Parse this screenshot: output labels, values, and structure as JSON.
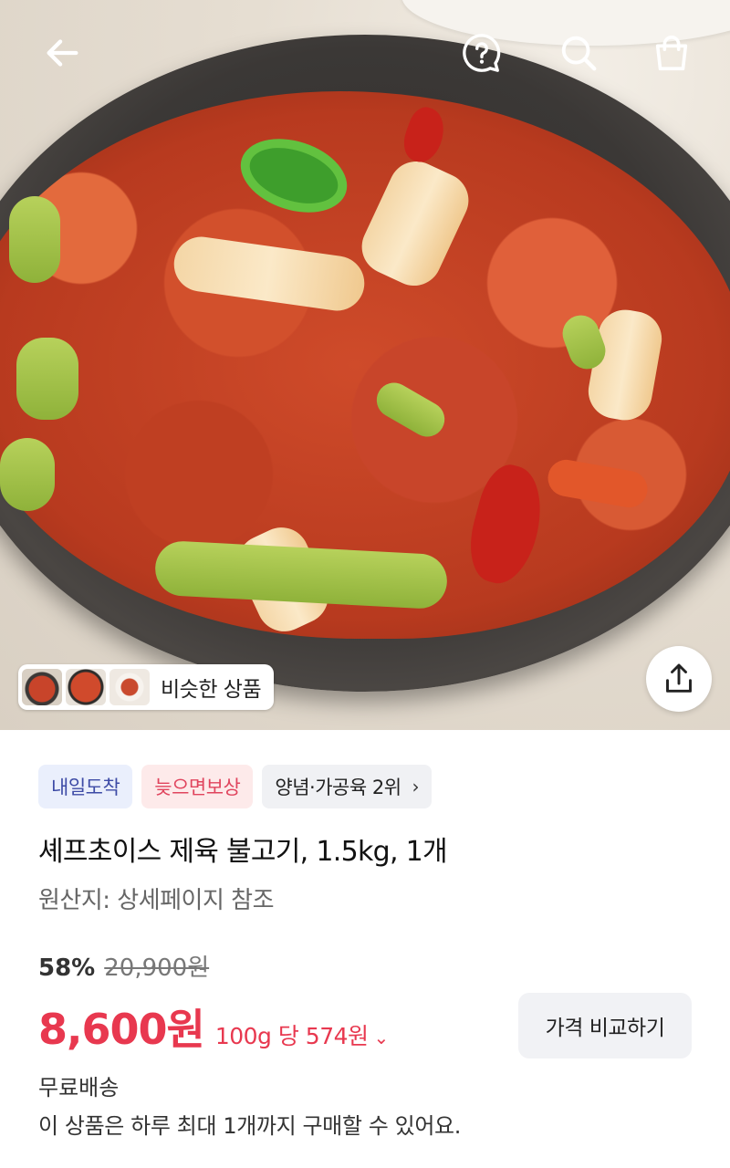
{
  "header": {
    "back_icon": "arrow-left-icon",
    "help_icon": "question-bubble-icon",
    "search_icon": "search-icon",
    "cart_icon": "shopping-bag-icon"
  },
  "hero": {
    "similar_label": "비슷한 상품",
    "share_icon": "share-icon"
  },
  "tags": [
    {
      "label": "내일도착",
      "color": "#3d4ba6"
    },
    {
      "label": "늦으면보상",
      "color": "#e0445d"
    },
    {
      "label": "양념·가공육 2위",
      "color": "#222222"
    }
  ],
  "product": {
    "title": "셰프초이스 제육 불고기, 1.5kg, 1개",
    "origin": "원산지: 상세페이지 참조",
    "discount": "58%",
    "original_price": "20,900원",
    "price": "8,600원",
    "unit_price": "100g 당 574원",
    "compare_label": "가격 비교하기",
    "shipping": "무료배송",
    "purchase_limit": "이 상품은 하루 최대 1개까지 구매할 수 있어요."
  },
  "colors": {
    "price_red": "#e8384f",
    "tag_blue_bg": "#eaeffc",
    "tag_pink_bg": "#fdeaea"
  }
}
